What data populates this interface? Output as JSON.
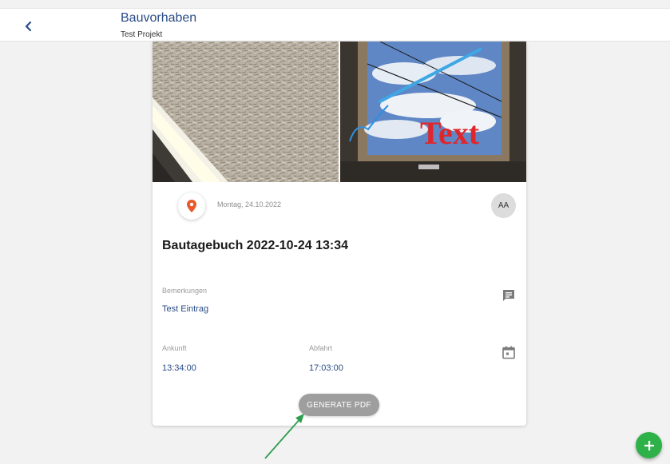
{
  "header": {
    "title": "Bauvorhaben",
    "subtitle": "Test Projekt"
  },
  "card": {
    "photo_overlay_text": "Text",
    "date": "Montag, 24.10.2022",
    "avatar_initials": "AA",
    "title": "Bautagebuch 2022-10-24 13:34",
    "remarks": {
      "label": "Bemerkungen",
      "value": "Test Eintrag"
    },
    "arrival": {
      "label": "Ankunft",
      "value": "13:34:00"
    },
    "departure": {
      "label": "Abfahrt",
      "value": "17:03:00"
    },
    "generate_pdf_label": "GENERATE PDF"
  },
  "colors": {
    "primary": "#2a4c86",
    "fab": "#2fb14a",
    "location_pin": "#e8582b",
    "annotation_arrow": "#2e9e4f",
    "overlay_text": "#e0262a"
  },
  "icons": {
    "back": "chevron-left-icon",
    "location": "location-pin-icon",
    "remarks": "comment-icon",
    "times": "calendar-icon",
    "fab": "plus-icon"
  }
}
